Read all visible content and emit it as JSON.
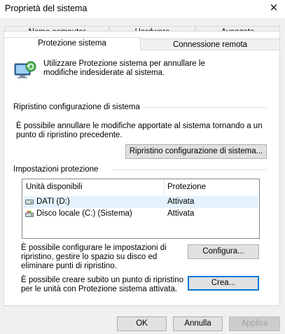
{
  "window": {
    "title": "Proprietà del sistema",
    "close_glyph": "✕"
  },
  "tabs": {
    "nome_computer": "Nome computer",
    "hardware": "Hardware",
    "avanzate": "Avanzate",
    "protezione_sistema": "Protezione sistema",
    "connessione_remota": "Connessione remota",
    "active": "Protezione sistema"
  },
  "intro": {
    "text": "Utilizzare Protezione sistema per annullare le modifiche indesiderate al sistema."
  },
  "restore": {
    "group_label": "Ripristino configurazione di sistema",
    "description": "È possibile annullare le modifiche apportate al sistema tornando a un punto di ripristino precedente.",
    "button_label": "Ripristino configurazione di sistema..."
  },
  "protection": {
    "group_label": "Impostazioni protezione",
    "columns": {
      "drives": "Unità disponibili",
      "protection": "Protezione"
    },
    "drives": [
      {
        "name": "DATI (D:)",
        "status": "Attivata",
        "icon": "drive-icon",
        "selected": true
      },
      {
        "name": "Disco locale (C:) (Sistema)",
        "status": "Attivata",
        "icon": "system-drive-icon",
        "selected": false
      }
    ],
    "configure_text": "È possibile configurare le impostazioni di ripristino, gestire lo spazio su disco ed eliminare punti di ripristino.",
    "configure_button": "Configura...",
    "create_text": "È possibile creare subito un punto di ripristino per le unità con Protezione sistema attivata.",
    "create_button": "Crea..."
  },
  "footer": {
    "ok": "OK",
    "cancel": "Annulla",
    "apply": "Applica"
  },
  "colors": {
    "focus": "#0078d7",
    "selection": "#e5f3ff"
  }
}
